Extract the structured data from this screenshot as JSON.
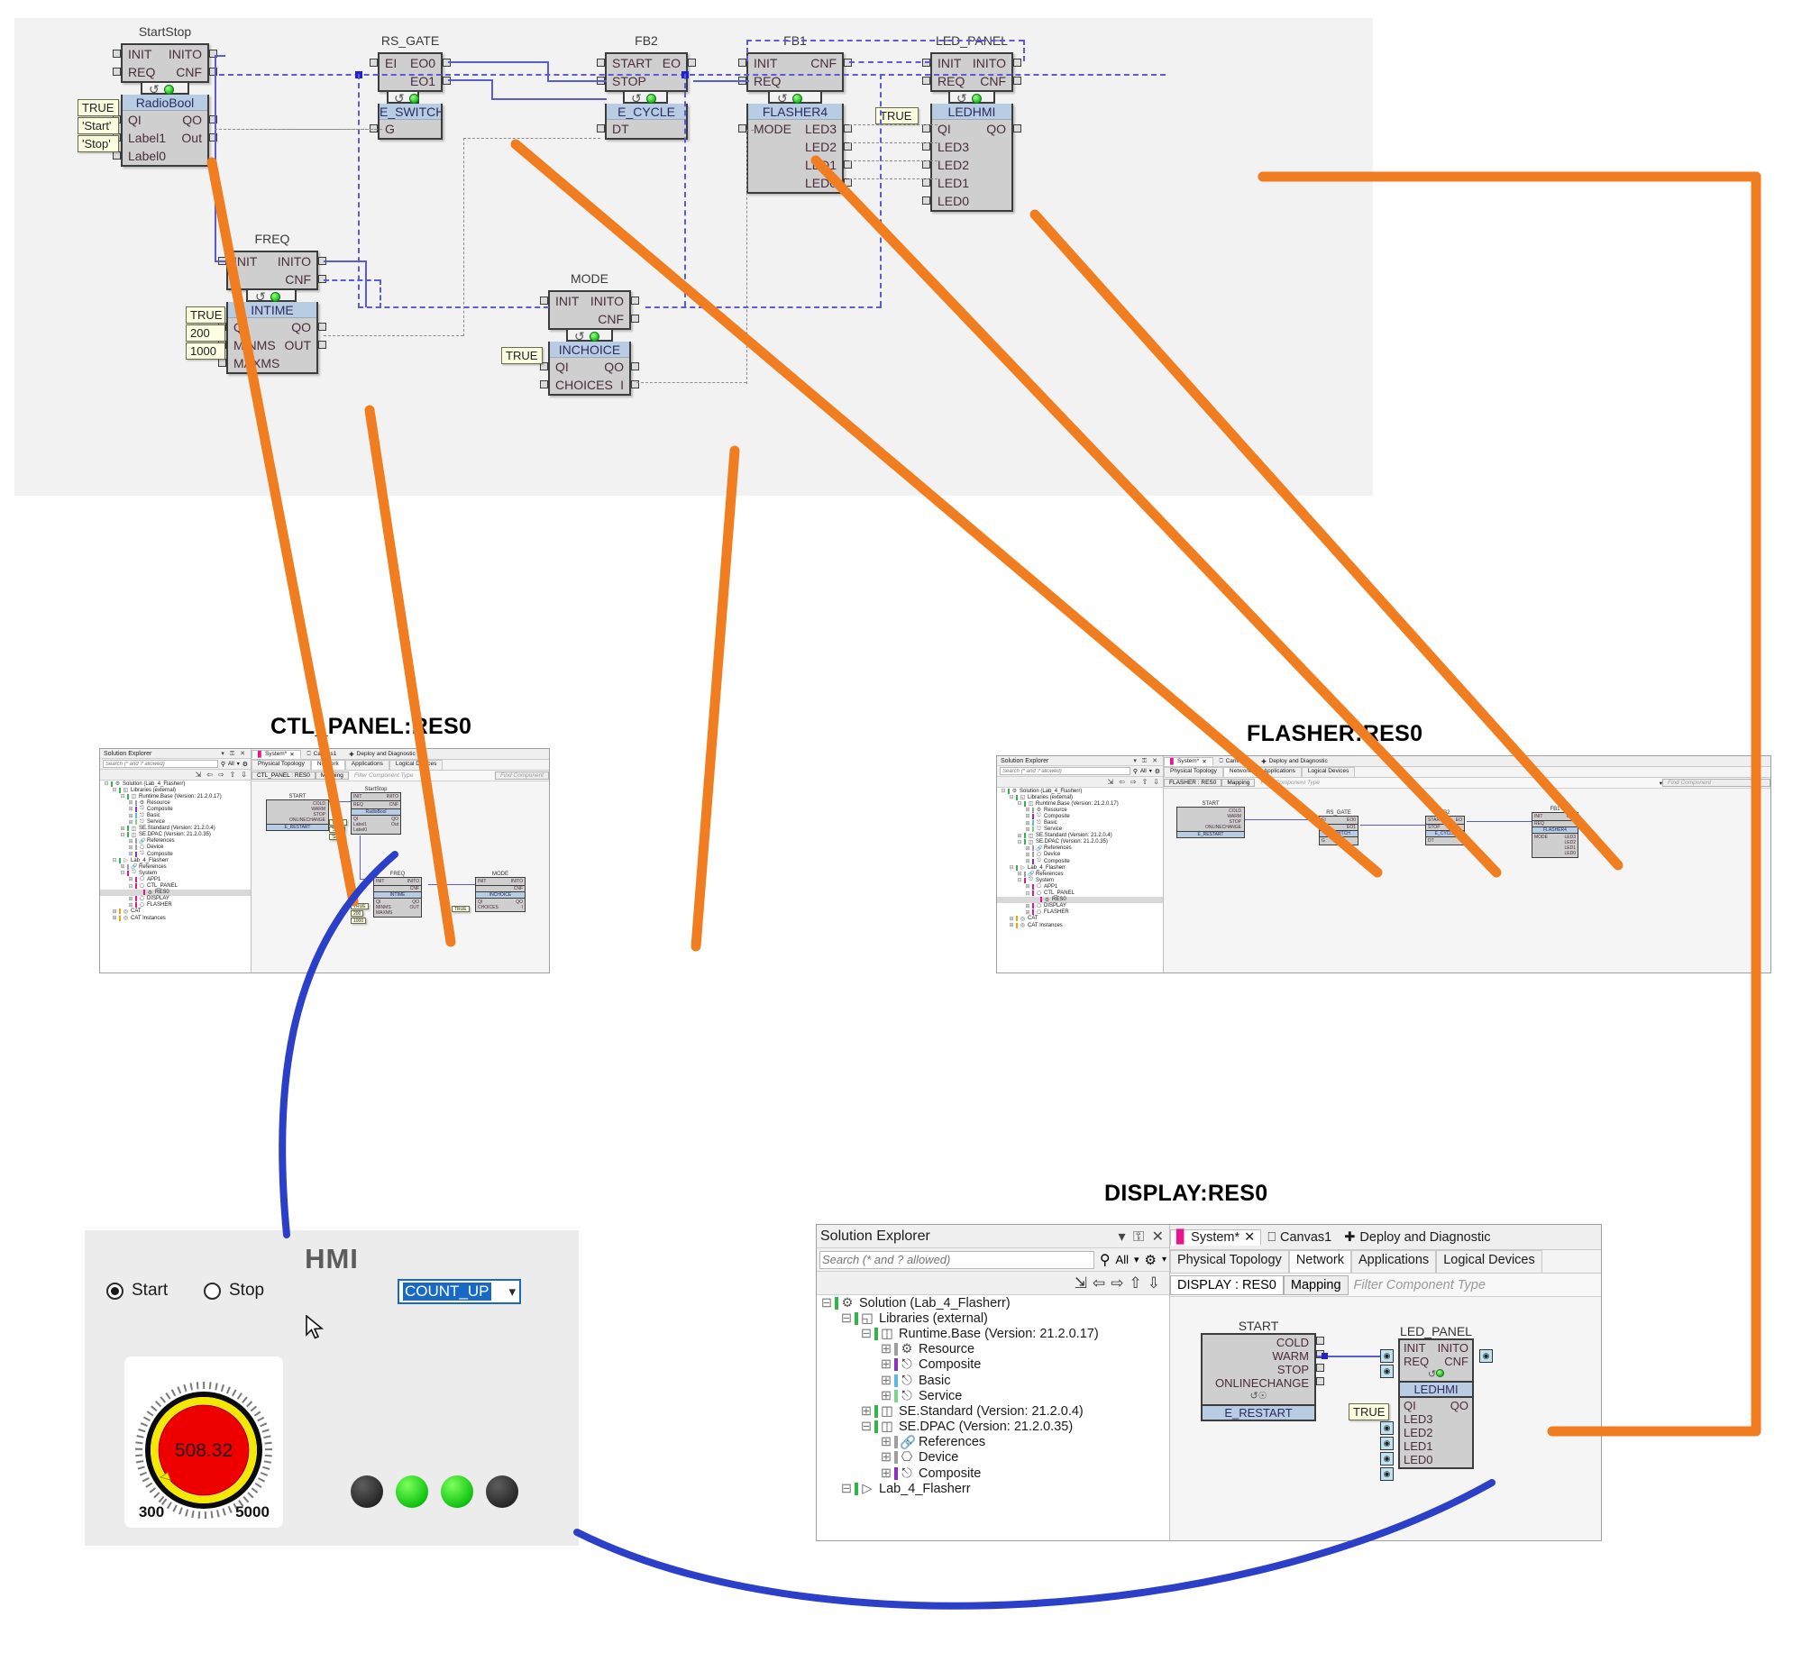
{
  "main_canvas": {
    "blocks": [
      {
        "id": "startstop",
        "title": "StartStop",
        "type": "RadioBool",
        "head_left": [
          "INIT",
          "REQ"
        ],
        "head_right": [
          "INITO",
          "CNF"
        ],
        "body_left": [
          "QI",
          "Label1",
          "Label0"
        ],
        "body_right": [
          "QO",
          "Out"
        ],
        "literals": [
          "TRUE",
          "'Start'",
          "'Stop'"
        ]
      },
      {
        "id": "rs_gate",
        "title": "RS_GATE",
        "type": "E_SWITCH",
        "head_left": [
          "EI"
        ],
        "head_right": [
          "EO0",
          "EO1"
        ],
        "body_left": [
          "G"
        ],
        "body_right": [],
        "literals": []
      },
      {
        "id": "fb2",
        "title": "FB2",
        "type": "E_CYCLE",
        "head_left": [
          "START",
          "STOP"
        ],
        "head_right": [
          "EO"
        ],
        "body_left": [
          "DT"
        ],
        "body_right": [],
        "literals": []
      },
      {
        "id": "fb1",
        "title": "FB1",
        "type": "FLASHER4",
        "head_left": [
          "INIT",
          "REQ"
        ],
        "head_right": [
          "CNF"
        ],
        "body_left": [
          "MODE"
        ],
        "body_right": [
          "LED3",
          "LED2",
          "LED1",
          "LED0"
        ],
        "literals": []
      },
      {
        "id": "led_panel",
        "title": "LED_PANEL",
        "type": "LEDHMI",
        "head_left": [
          "INIT",
          "REQ"
        ],
        "head_right": [
          "INITO",
          "CNF"
        ],
        "body_left": [
          "QI",
          "LED3",
          "LED2",
          "LED1",
          "LED0"
        ],
        "body_right": [
          "QO"
        ],
        "literals": [
          "TRUE"
        ]
      },
      {
        "id": "freq",
        "title": "FREQ",
        "type": "INTIME",
        "head_left": [
          "INIT"
        ],
        "head_right": [
          "INITO",
          "CNF"
        ],
        "body_left": [
          "QI",
          "MINMS",
          "MAXMS"
        ],
        "body_right": [
          "QO",
          "OUT"
        ],
        "literals": [
          "TRUE",
          "200",
          "1000"
        ]
      },
      {
        "id": "mode",
        "title": "MODE",
        "type": "INCHOICE",
        "head_left": [
          "INIT"
        ],
        "head_right": [
          "INITO",
          "CNF"
        ],
        "body_left": [
          "QI",
          "CHOICES"
        ],
        "body_right": [
          "QO",
          "I"
        ],
        "literals": [
          "TRUE"
        ]
      }
    ]
  },
  "panels": {
    "ctl_panel": {
      "title": "CTL_PANEL:RES0",
      "solution_explorer": {
        "header": "Solution Explorer",
        "search_placeholder": "Search (* and ? allowed)",
        "scope": "All"
      },
      "tabs": [
        {
          "label": "System*",
          "active": true,
          "closable": true
        },
        {
          "label": "Canvas1",
          "active": false
        },
        {
          "label": "Deploy and Diagnostic",
          "active": false
        }
      ],
      "subtabs": [
        "Physical Topology",
        "Network",
        "Applications",
        "Logical Devices"
      ],
      "active_subtab": "Network",
      "resource_tab": "CTL_PANEL : RES0",
      "mapping_tab": "Mapping",
      "filter_placeholder": "Filter Component Type",
      "find_placeholder": "Find Component",
      "canvas_blocks": [
        "START",
        "StartStop",
        "FREQ",
        "MODE"
      ]
    },
    "flasher": {
      "title": "FLASHER:RES0",
      "solution_explorer": {
        "header": "Solution Explorer",
        "search_placeholder": "Search (* and ? allowed)",
        "scope": "All"
      },
      "tabs": [
        {
          "label": "System*",
          "active": true,
          "closable": true
        },
        {
          "label": "Canvas1",
          "active": false
        },
        {
          "label": "Deploy and Diagnostic",
          "active": false
        }
      ],
      "subtabs": [
        "Physical Topology",
        "Network",
        "Applications",
        "Logical Devices"
      ],
      "active_subtab": "Network",
      "resource_tab": "FLASHER : RES0",
      "mapping_tab": "Mapping",
      "filter_placeholder": "Filter Component Type",
      "find_placeholder": "Find Component",
      "canvas_blocks": [
        "START",
        "RS_GATE",
        "FB2",
        "FB1"
      ]
    },
    "display": {
      "title": "DISPLAY:RES0",
      "solution_explorer": {
        "header": "Solution Explorer",
        "search_placeholder": "Search (* and ? allowed)",
        "scope": "All"
      },
      "tabs": [
        {
          "label": "System*",
          "active": true,
          "closable": true
        },
        {
          "label": "Canvas1",
          "active": false
        },
        {
          "label": "Deploy and Diagnostic",
          "active": false
        }
      ],
      "subtabs": [
        "Physical Topology",
        "Network",
        "Applications",
        "Logical Devices"
      ],
      "active_subtab": "Network",
      "resource_tab": "DISPLAY : RES0",
      "mapping_tab": "Mapping",
      "filter_placeholder": "Filter Component Type",
      "canvas_blocks": [
        "START",
        "LED_PANEL"
      ]
    }
  },
  "solution_tree": [
    {
      "depth": 0,
      "label": "Solution  (Lab_4_Flasherr)",
      "icon": "solution-icon",
      "bar": "#33b44a",
      "expanded": true
    },
    {
      "depth": 1,
      "label": "Libraries (external)",
      "icon": "folder-icon",
      "bar": "#33b44a",
      "expanded": true
    },
    {
      "depth": 2,
      "label": "Runtime.Base  (Version: 21.2.0.17)",
      "icon": "library-icon",
      "bar": "#33b44a",
      "expanded": true
    },
    {
      "depth": 3,
      "label": "Resource",
      "icon": "resource-icon",
      "bar": "#9e9e9e",
      "expanded": false
    },
    {
      "depth": 3,
      "label": "Composite",
      "icon": "composite-icon",
      "bar": "#8e30c4",
      "expanded": false
    },
    {
      "depth": 3,
      "label": "Basic",
      "icon": "basic-icon",
      "bar": "#5bb8e8",
      "expanded": false
    },
    {
      "depth": 3,
      "label": "Service",
      "icon": "service-icon",
      "bar": "#7fd48a",
      "expanded": false
    },
    {
      "depth": 2,
      "label": "SE.Standard  (Version: 21.2.0.4)",
      "icon": "library-icon",
      "bar": "#33b44a",
      "expanded": false
    },
    {
      "depth": 2,
      "label": "SE.DPAC  (Version: 21.2.0.35)",
      "icon": "library-icon",
      "bar": "#33b44a",
      "expanded": true
    },
    {
      "depth": 3,
      "label": "References",
      "icon": "reference-icon",
      "bar": "#9e9e9e",
      "expanded": false
    },
    {
      "depth": 3,
      "label": "Device",
      "icon": "device-icon",
      "bar": "#9e9e9e",
      "expanded": false
    },
    {
      "depth": 3,
      "label": "Composite",
      "icon": "composite-icon",
      "bar": "#8e30c4",
      "expanded": false
    },
    {
      "depth": 1,
      "label": "Lab_4_Flasherr",
      "icon": "project-icon",
      "bar": "#33b44a",
      "expanded": true
    }
  ],
  "solution_tree_extended": [
    {
      "depth": 2,
      "label": "References",
      "icon": "reference-icon",
      "bar": "#9e9e9e",
      "expanded": false
    },
    {
      "depth": 2,
      "label": "System",
      "icon": "system-icon",
      "bar": "#e8158f",
      "expanded": true
    },
    {
      "depth": 3,
      "label": "APP1",
      "icon": "app-icon",
      "bar": "#e8158f",
      "expanded": false
    },
    {
      "depth": 3,
      "label": "CTL_PANEL",
      "icon": "device-icon",
      "bar": "#e8158f",
      "expanded": true
    },
    {
      "depth": 4,
      "label": "RES0",
      "icon": "resource-icon",
      "bar": "#e8158f",
      "selected": true
    },
    {
      "depth": 3,
      "label": "DISPLAY",
      "icon": "device-icon",
      "bar": "#e8158f",
      "expanded": false
    },
    {
      "depth": 3,
      "label": "FLASHER",
      "icon": "device-icon",
      "bar": "#e8158f",
      "expanded": false
    },
    {
      "depth": 1,
      "label": "CAT",
      "icon": "cat-icon",
      "bar": "#f0a010",
      "expanded": false
    },
    {
      "depth": 1,
      "label": "CAT Instances",
      "icon": "cat-icon",
      "bar": "#f0a010",
      "expanded": false
    }
  ],
  "hmi": {
    "title": "HMI",
    "radios": [
      {
        "label": "Start",
        "selected": true
      },
      {
        "label": "Stop",
        "selected": false
      }
    ],
    "combo": {
      "value": "COUNT_UP",
      "caret": "chevron-down-icon"
    },
    "gauge": {
      "value": "508.32",
      "min": "300",
      "max": "5000",
      "face_color": "#ee0000",
      "ring_color": "#f5e800"
    },
    "leds": [
      {
        "state": "off"
      },
      {
        "state": "on"
      },
      {
        "state": "on"
      },
      {
        "state": "off"
      }
    ]
  },
  "start_block": {
    "title": "START",
    "type": "E_RESTART",
    "outputs": [
      "COLD",
      "WARM",
      "STOP",
      "ONLINECHANGE"
    ]
  },
  "colors": {
    "mapping_line": "#f07e20",
    "hmi_link_line": "#2b3fc8",
    "wire": "#5b5bd6",
    "data_wire": "#8c8c8c",
    "block_fill": "#cfcfcf",
    "block_name_fill": "#b8cce4",
    "literal_fill": "#fdfde2"
  }
}
